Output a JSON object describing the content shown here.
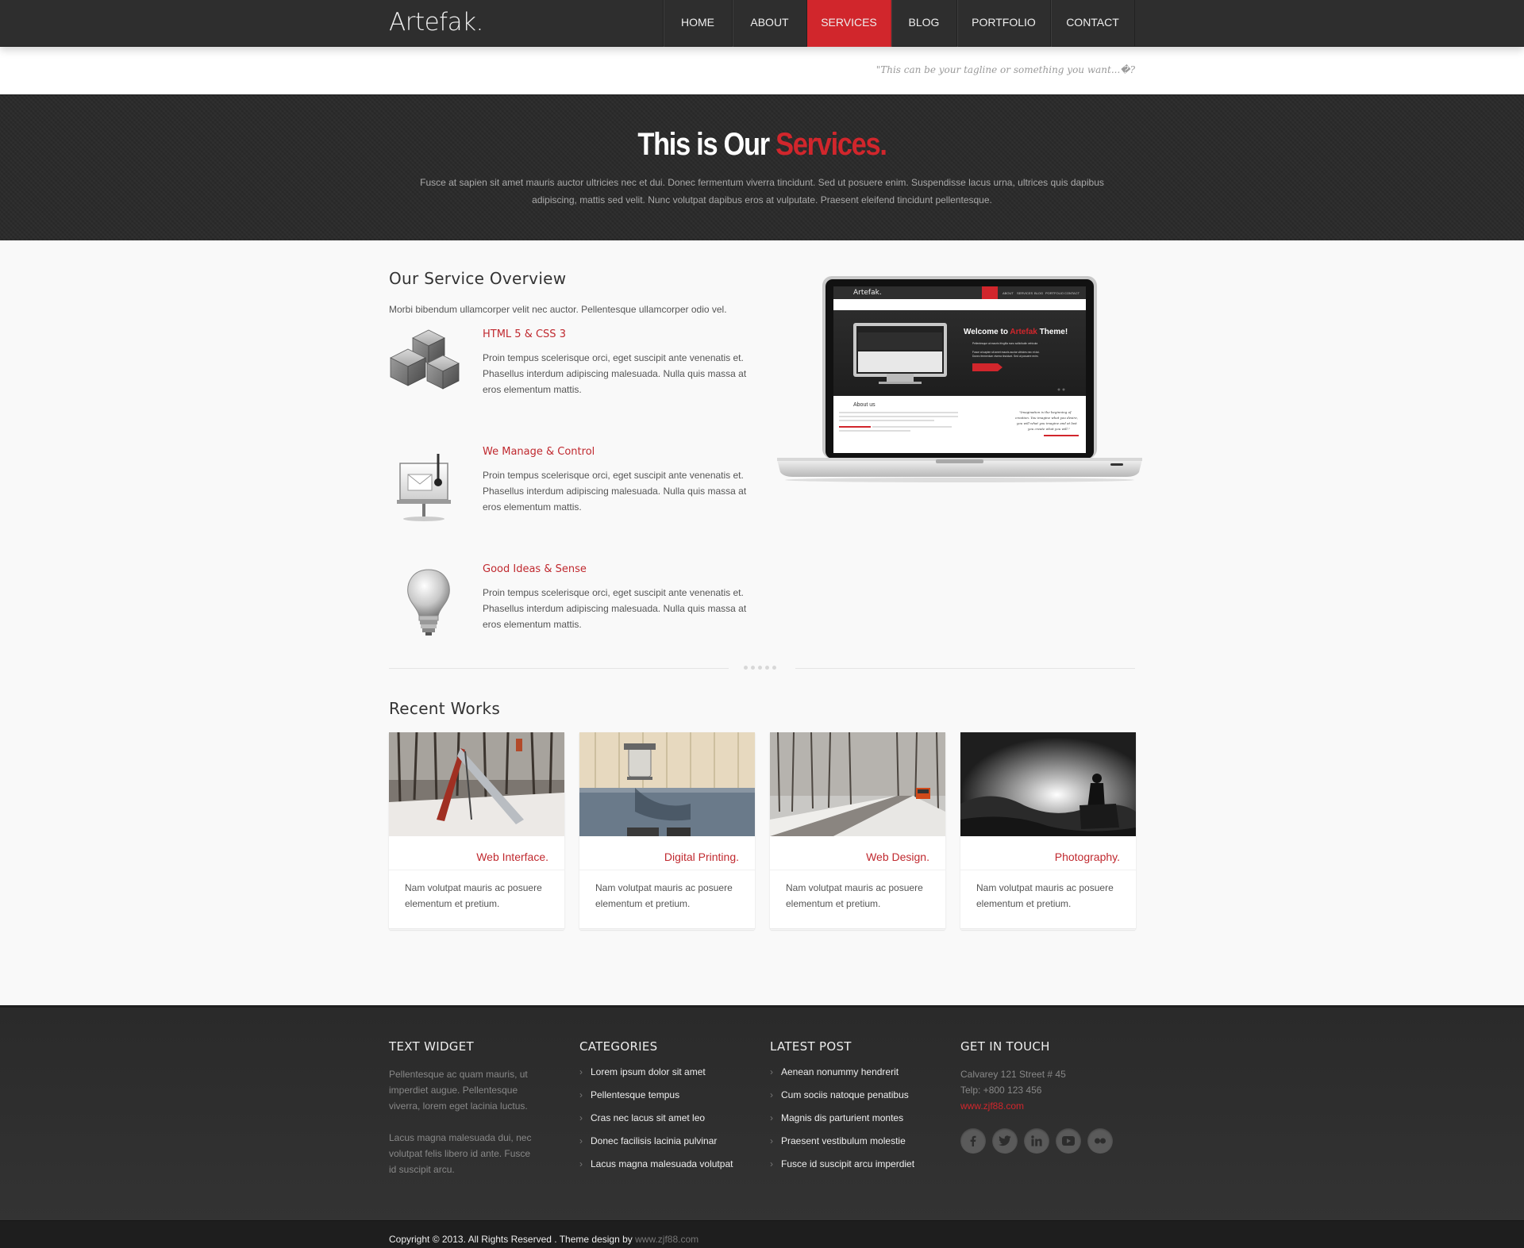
{
  "header": {
    "logo": "Artefak.",
    "nav": [
      {
        "label": "HOME",
        "active": false
      },
      {
        "label": "ABOUT",
        "active": false
      },
      {
        "label": "SERVICES",
        "active": true
      },
      {
        "label": "BLOG",
        "active": false
      },
      {
        "label": "PORTFOLIO",
        "active": false
      },
      {
        "label": "CONTACT",
        "active": false
      }
    ],
    "tagline": "\"This can be your tagline or something you want...�?"
  },
  "hero": {
    "title_part1": "This is Our",
    "title_accent": "Services.",
    "text": "Fusce at sapien sit amet mauris auctor ultricies nec et dui. Donec fermentum viverra tincidunt. Sed ut posuere enim. Suspendisse lacus urna, ultrices quis dapibus adipiscing, mattis sed velit. Nunc volutpat dapibus eros at vulputate. Praesent eleifend tincidunt pellentesque."
  },
  "overview": {
    "title": "Our Service Overview",
    "intro": "Morbi bibendum ullamcorper velit nec auctor. Pellentesque ullamcorper odio vel.",
    "services": [
      {
        "title": "HTML 5 & CSS 3",
        "icon": "cubes-icon",
        "text": "Proin tempus scelerisque orci, eget suscipit ante venenatis et. Phasellus interdum adipiscing malesuada. Nulla quis massa at eros elementum mattis."
      },
      {
        "title": "We Manage & Control",
        "icon": "presentation-board-icon",
        "text": "Proin tempus scelerisque orci, eget suscipit ante venenatis et. Phasellus interdum adipiscing malesuada. Nulla quis massa at eros elementum mattis."
      },
      {
        "title": "Good Ideas & Sense",
        "icon": "lightbulb-icon",
        "text": "Proin tempus scelerisque orci, eget suscipit ante venenatis et. Phasellus interdum adipiscing malesuada. Nulla quis massa at eros elementum mattis."
      }
    ]
  },
  "laptop_screen": {
    "logo": "Artefak.",
    "welcome_part1": "Welcome to",
    "welcome_accent": "Artefak",
    "welcome_part2": "Theme!",
    "about": "About us"
  },
  "recent": {
    "title": "Recent Works",
    "works": [
      {
        "title": "Web Interface.",
        "text": "Nam volutpat mauris ac posuere elementum et pretium.",
        "image": "snowy-playground-slide"
      },
      {
        "title": "Digital Printing.",
        "text": "Nam volutpat mauris ac posuere elementum et pretium.",
        "image": "wall-lamp-building"
      },
      {
        "title": "Web Design.",
        "text": "Nam volutpat mauris ac posuere elementum et pretium.",
        "image": "winter-road-bus"
      },
      {
        "title": "Photography.",
        "text": "Nam volutpat mauris ac posuere elementum et pretium.",
        "image": "backlit-rider-silhouette"
      }
    ]
  },
  "footer": {
    "text_widget": {
      "title": "TEXT WIDGET",
      "p1": "Pellentesque ac quam mauris, ut imperdiet augue. Pellentesque viverra, lorem eget lacinia luctus.",
      "p2": "Lacus magna malesuada dui, nec volutpat felis libero id ante. Fusce id suscipit arcu."
    },
    "categories": {
      "title": "CATEGORIES",
      "items": [
        "Lorem ipsum dolor sit amet",
        "Pellentesque tempus",
        "Cras nec lacus sit amet leo",
        "Donec facilisis lacinia pulvinar",
        "Lacus magna malesuada volutpat"
      ]
    },
    "latest_post": {
      "title": "LATEST POST",
      "items": [
        "Aenean nonummy hendrerit",
        "Cum sociis natoque penatibus",
        "Magnis dis parturient montes",
        "Praesent vestibulum molestie",
        "Fusce id suscipit arcu imperdiet"
      ]
    },
    "contact": {
      "title": "GET IN TOUCH",
      "address": "Calvarey 121 Street # 45",
      "phone": "Telp: +800 123 456",
      "website": "www.zjf88.com",
      "social": [
        "facebook-icon",
        "twitter-icon",
        "linkedin-icon",
        "youtube-icon",
        "flickr-icon"
      ]
    }
  },
  "bottom": {
    "copyright": "Copyright © 2013. All Rights Reserved . Theme design by",
    "credit": "www.zjf88.com"
  },
  "colors": {
    "accent": "#d1262c",
    "header": "#2e2e2e",
    "footer": "#2d2d2d"
  }
}
